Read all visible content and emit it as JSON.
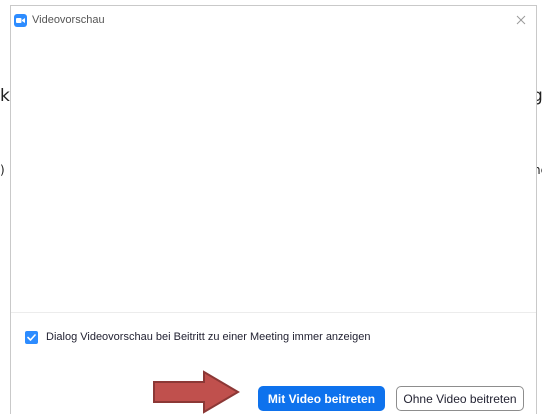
{
  "background_fragments": {
    "left_top": "k",
    "right_top": "g",
    "left_mid": ")",
    "right_mid": "nc"
  },
  "dialog": {
    "title": "Videovorschau",
    "icon": "zoom-video-icon",
    "checkbox": {
      "label": "Dialog Videovorschau bei Beitritt zu einer Meeting immer anzeigen",
      "checked": true
    },
    "buttons": {
      "primary_label": "Mit Video beitreten",
      "secondary_label": "Ohne Video beitreten"
    }
  },
  "colors": {
    "accent": "#0e72ed",
    "checkbox": "#2d8cff",
    "arrow_fill": "#c0504d",
    "arrow_stroke": "#8c3836"
  }
}
